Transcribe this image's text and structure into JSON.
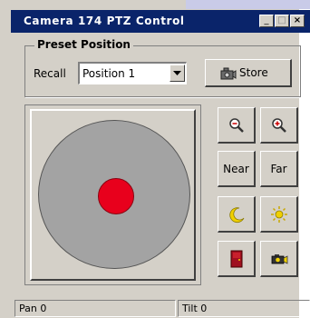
{
  "window": {
    "title": "Camera 174 PTZ Control",
    "controls": {
      "minimize": "_",
      "maximize": "□",
      "close": "×"
    }
  },
  "preset": {
    "group_label": "Preset Position",
    "recall_label": "Recall",
    "recall_selected": "Position 1",
    "store_label": "Store"
  },
  "pad": {
    "outer_color": "#a3a3a3",
    "center_color": "#e8001c"
  },
  "controls": {
    "zoom_out_icon": "zoom-out-magnifier-icon",
    "zoom_in_icon": "zoom-in-magnifier-icon",
    "near_label": "Near",
    "far_label": "Far",
    "night_icon": "moon-icon",
    "day_icon": "sun-icon",
    "stop_icon": "door-icon",
    "snapshot_icon": "camera-icon"
  },
  "status": {
    "pan": "Pan 0",
    "tilt": "Tilt 0"
  },
  "colors": {
    "titlebar": "#0a246a",
    "face": "#d4d0c8",
    "accent_red": "#e8001c",
    "accent_yellow": "#f0d000"
  }
}
